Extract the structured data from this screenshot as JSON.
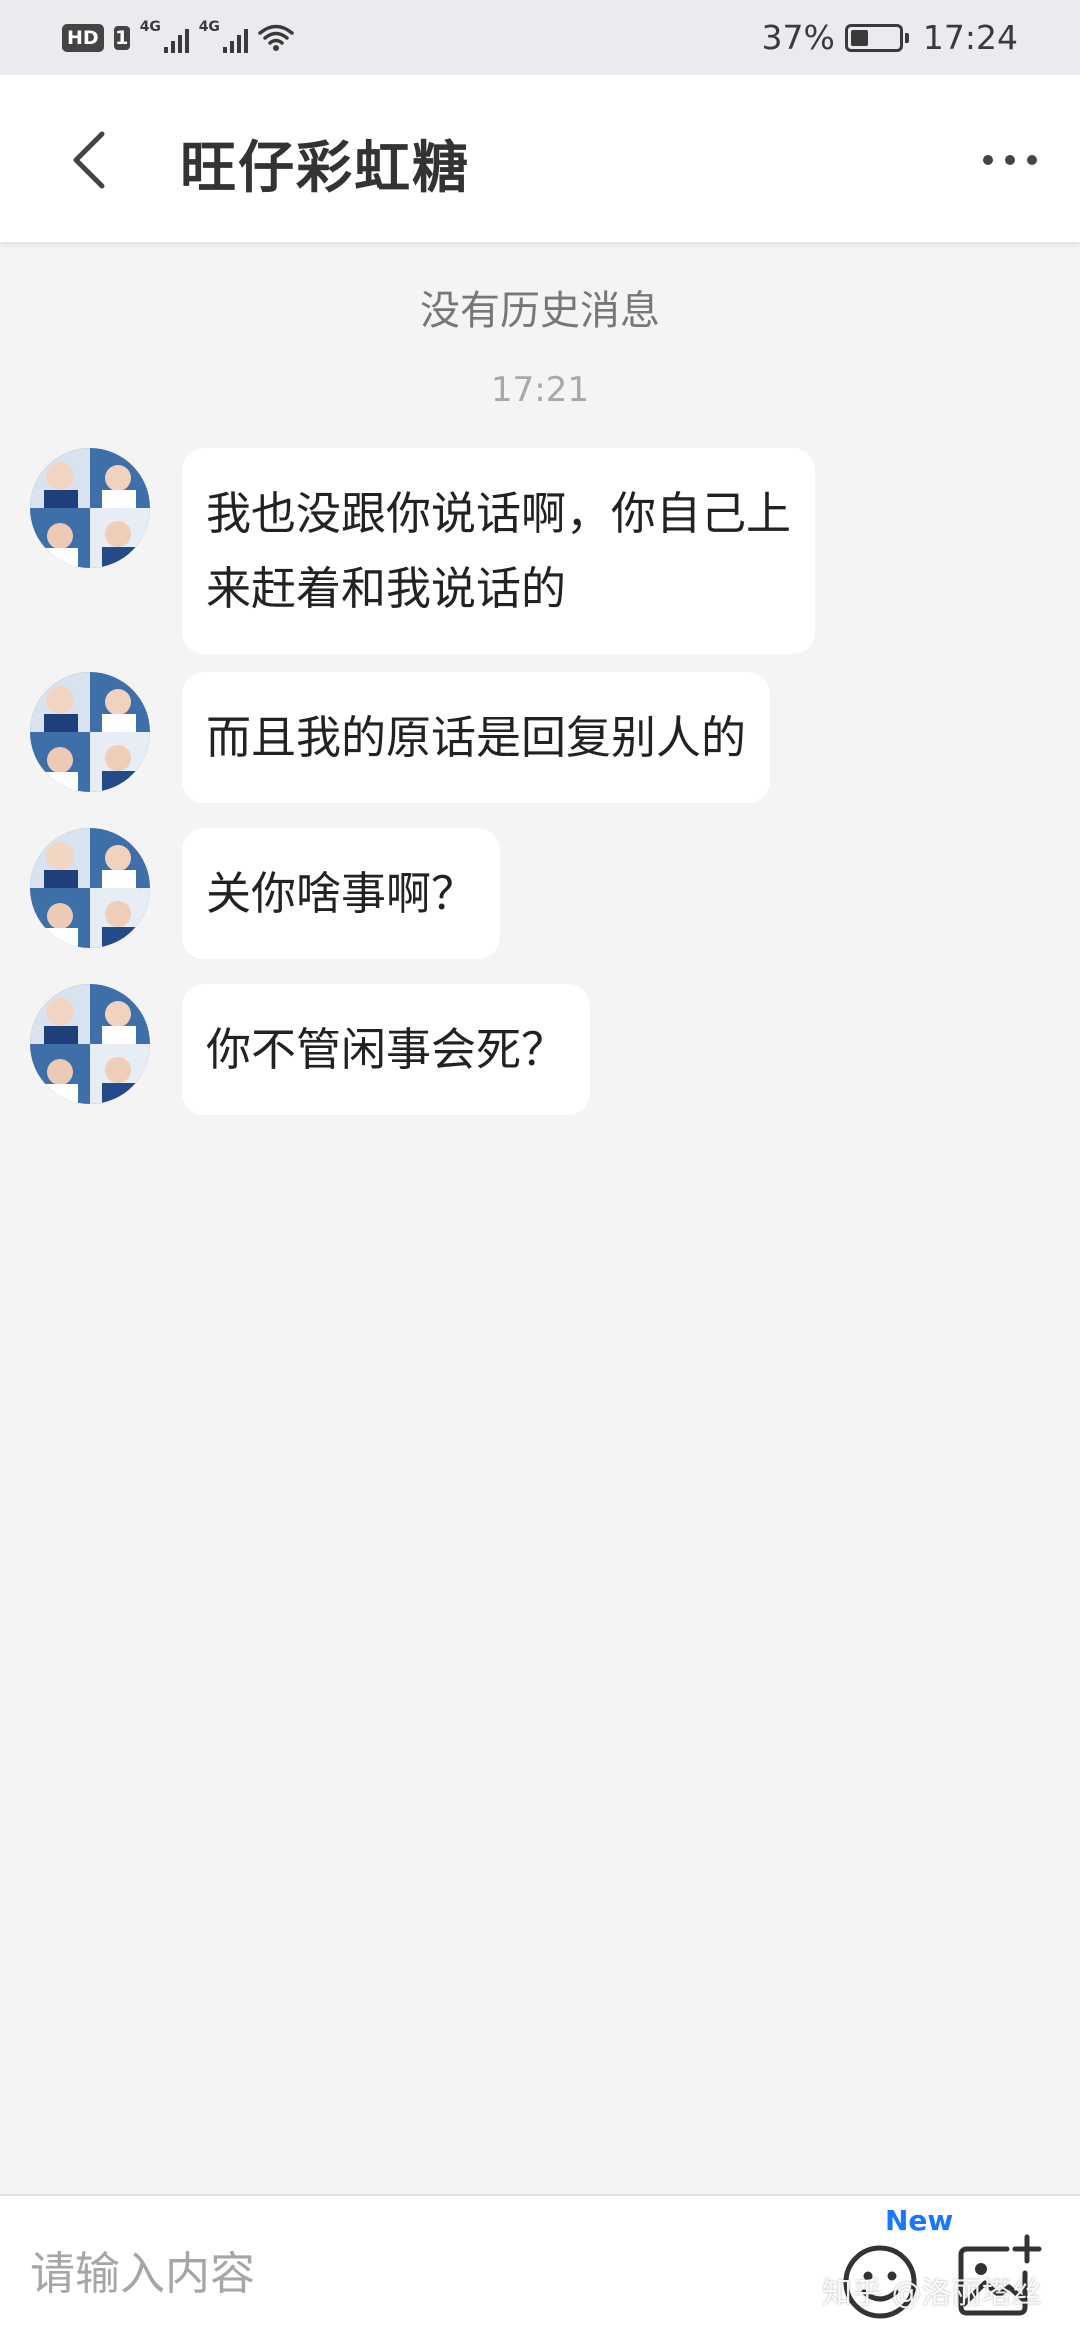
{
  "status_bar": {
    "hd": "HD",
    "sim": "1",
    "network1": "4G",
    "network2": "4G",
    "battery_percent_text": "37%",
    "battery_level": 0.37,
    "time": "17:24"
  },
  "header": {
    "back_icon": "chevron-left-icon",
    "title": "旺仔彩虹糖",
    "more_icon": "more-dots-icon"
  },
  "chat": {
    "no_history": "没有历史消息",
    "timestamp": "17:21",
    "messages": [
      {
        "text_lines": [
          "我也没跟你说话啊，你自己上",
          "来赶着和我说话的"
        ]
      },
      {
        "text": "而且我的原话是回复别人的"
      },
      {
        "text": "关你啥事啊？"
      },
      {
        "text": "你不管闲事会死？"
      }
    ]
  },
  "input_bar": {
    "placeholder": "请输入内容",
    "emoji_icon": "emoji-icon",
    "new_badge": "New",
    "image_icon": "add-image-icon"
  },
  "watermark": "知乎 @洛丽塔丝",
  "colors": {
    "status_bar_bg": "#e9ebee",
    "chat_bg": "#f4f4f5",
    "bubble_bg": "#ffffff",
    "accent_blue": "#1677ff"
  }
}
